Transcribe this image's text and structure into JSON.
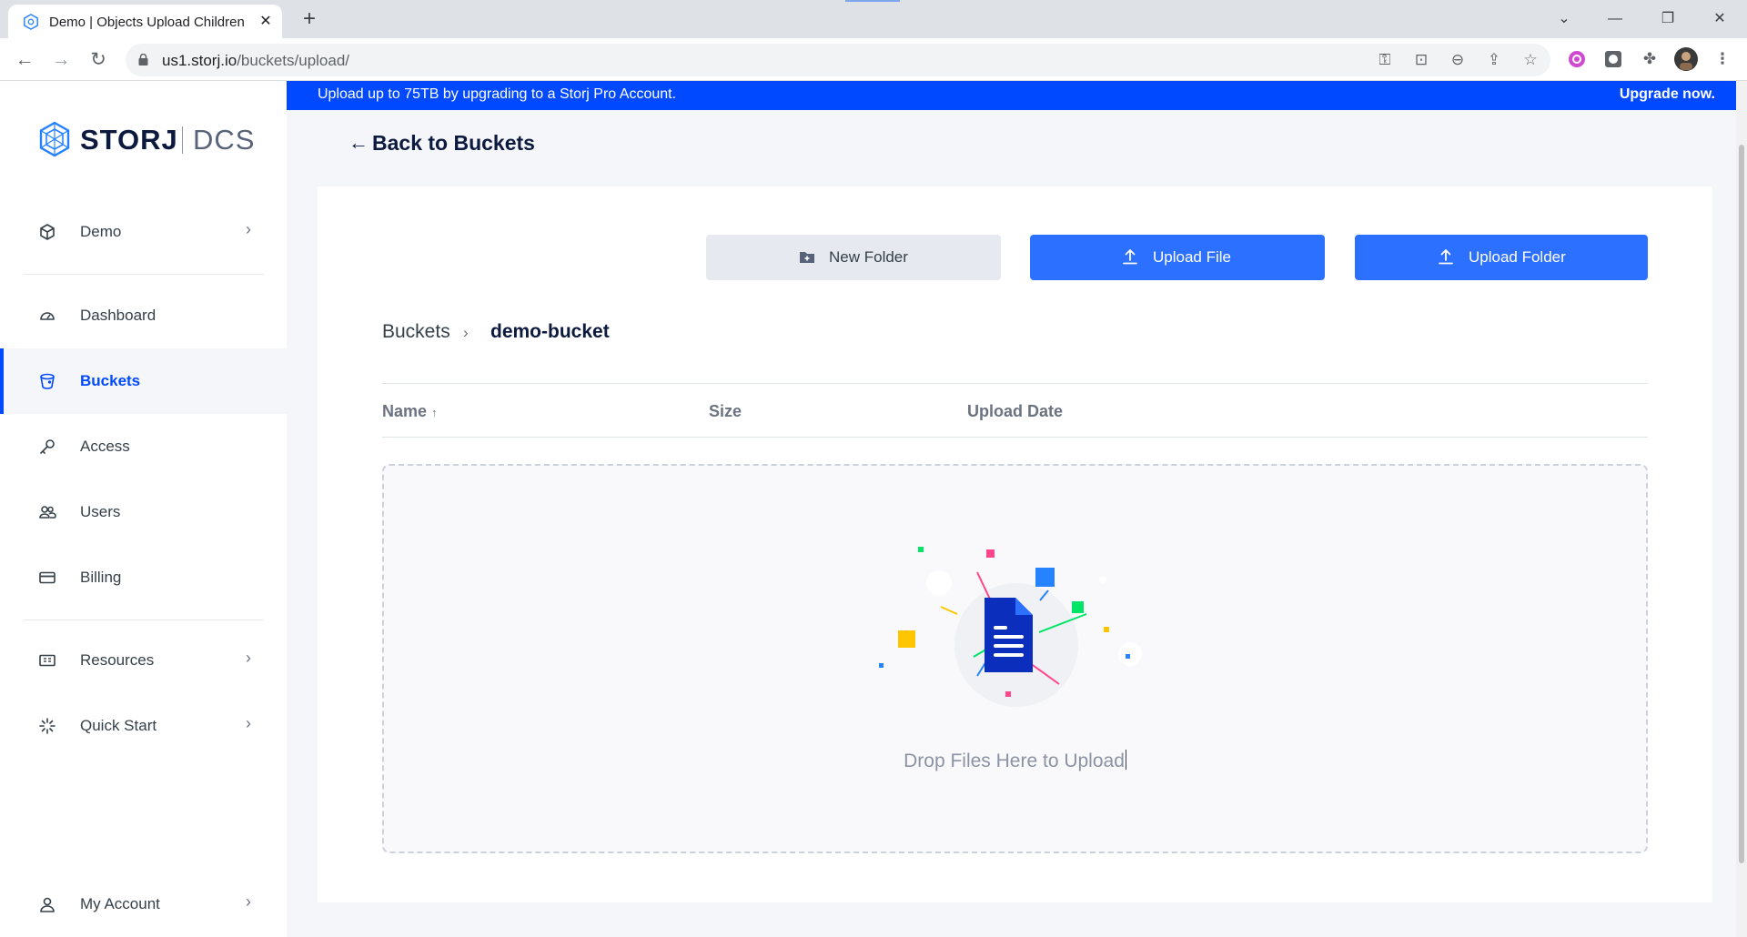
{
  "browser": {
    "tab_title": "Demo | Objects Upload Children",
    "tab_close": "✕",
    "new_tab": "+",
    "url_host": "us1.storj.io",
    "url_path": "/buckets/upload/",
    "window_controls": [
      "⌄",
      "—",
      "❐",
      "✕"
    ]
  },
  "banner": {
    "text": "Upload up to 75TB by upgrading to a Storj Pro Account.",
    "link": "Upgrade now."
  },
  "logo": {
    "brand": "STORJ",
    "product": "DCS"
  },
  "sidebar": {
    "project": {
      "label": "Demo",
      "icon": "cube-icon"
    },
    "items": [
      {
        "label": "Dashboard",
        "icon": "gauge-icon"
      },
      {
        "label": "Buckets",
        "icon": "bucket-icon",
        "active": true
      },
      {
        "label": "Access",
        "icon": "key-icon"
      },
      {
        "label": "Users",
        "icon": "users-icon"
      },
      {
        "label": "Billing",
        "icon": "card-icon"
      }
    ],
    "resources": {
      "label": "Resources",
      "icon": "resources-icon"
    },
    "quick_start": {
      "label": "Quick Start",
      "icon": "sparkle-icon"
    },
    "account": {
      "label": "My Account",
      "icon": "user-icon"
    }
  },
  "back": {
    "label": "Back to Buckets"
  },
  "actions": {
    "new_folder": "New Folder",
    "upload_file": "Upload File",
    "upload_folder": "Upload Folder"
  },
  "breadcrumb": {
    "root": "Buckets",
    "separator": "›",
    "current": "demo-bucket"
  },
  "table": {
    "columns": [
      "Name",
      "Size",
      "Upload Date"
    ],
    "sort_indicator": "↑"
  },
  "dropzone": {
    "text": "Drop Files Here to Upload"
  },
  "colors": {
    "accent": "#0149ff",
    "button_blue": "#2b70ff",
    "doc_blue": "#0c2ebd"
  }
}
